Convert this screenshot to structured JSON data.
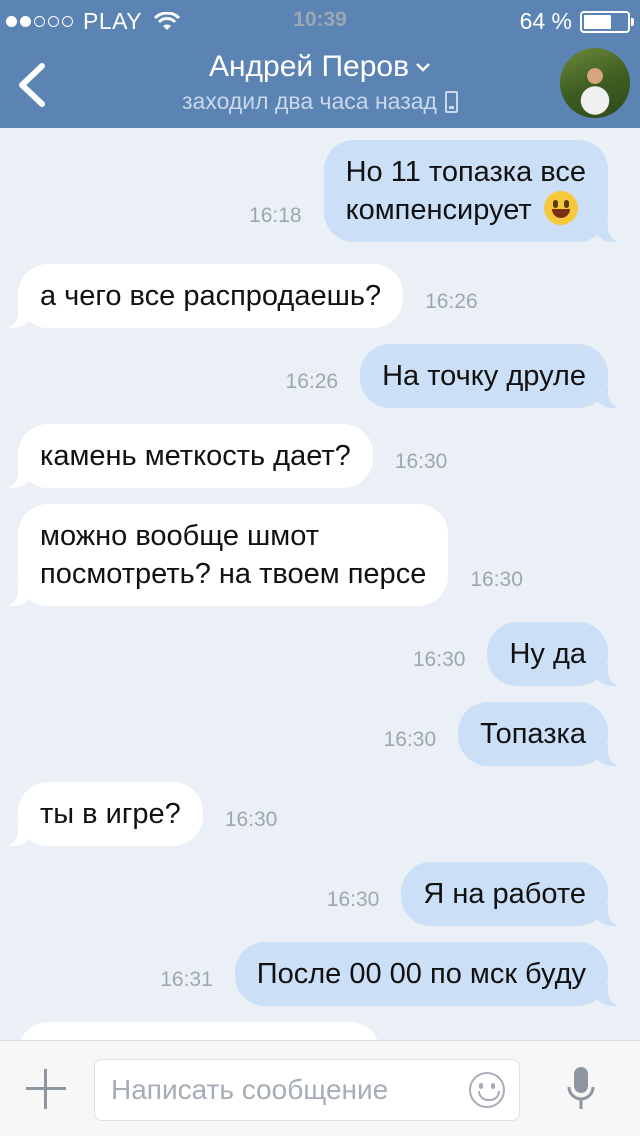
{
  "status_bar": {
    "carrier": "PLAY",
    "time": "10:39",
    "battery": "64 %",
    "battery_level": 0.64
  },
  "header": {
    "contact_name": "Андрей Перов",
    "last_seen": "заходил два часа назад"
  },
  "messages": [
    {
      "dir": "out",
      "lines": [
        "Но 11 топазка все",
        "компенсирует"
      ],
      "emoji": "smile-emoji",
      "time": "16:18"
    },
    {
      "dir": "in",
      "lines": [
        "а чего все распродаешь?"
      ],
      "time": "16:26"
    },
    {
      "dir": "out",
      "lines": [
        "На точку друле"
      ],
      "time": "16:26"
    },
    {
      "dir": "in",
      "lines": [
        "камень меткость дает?"
      ],
      "time": "16:30"
    },
    {
      "dir": "in",
      "lines": [
        "можно вообще шмот",
        "посмотреть? на твоем персе"
      ],
      "time": "16:30"
    },
    {
      "dir": "out",
      "lines": [
        "Ну да"
      ],
      "time": "16:30"
    },
    {
      "dir": "out",
      "lines": [
        "Топазка"
      ],
      "time": "16:30"
    },
    {
      "dir": "in",
      "lines": [
        "ты в игре?"
      ],
      "time": "16:30"
    },
    {
      "dir": "out",
      "lines": [
        "Я на работе"
      ],
      "time": "16:30"
    },
    {
      "dir": "out",
      "lines": [
        "После 00 00 по мск буду"
      ],
      "time": "16:31"
    },
    {
      "dir": "in",
      "lines": [
        ""
      ],
      "time": ""
    }
  ],
  "composer": {
    "placeholder": "Написать сообщение",
    "icons": [
      "plus-icon",
      "emoji-icon",
      "microphone-icon"
    ]
  },
  "colors": {
    "header_bg": "#5b83b3",
    "chat_bg": "#ebf0f6",
    "outgoing_bubble": "#cbdff7",
    "incoming_bubble": "#ffffff",
    "time_text": "#9ca7b4"
  }
}
